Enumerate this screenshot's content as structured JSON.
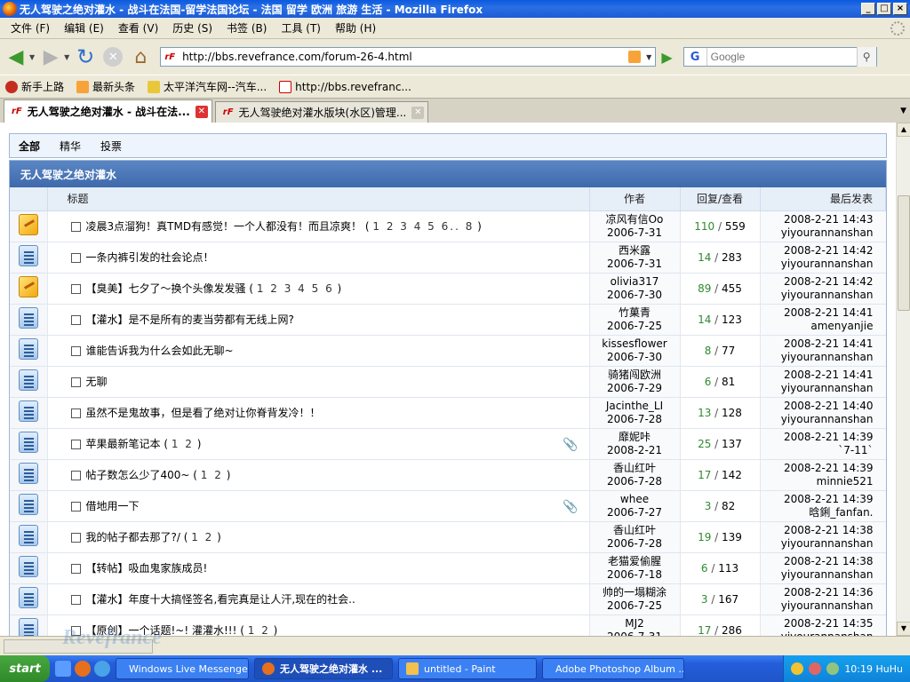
{
  "window": {
    "title": "无人驾驶之绝对灌水 - 战斗在法国-留学法国论坛 - 法国 留学 欧洲 旅游 生活 - Mozilla Firefox",
    "buttons": {
      "minimize": "_",
      "maximize": "□",
      "close": "×"
    }
  },
  "menubar": [
    "文件 (F)",
    "编辑 (E)",
    "查看 (V)",
    "历史 (S)",
    "书签 (B)",
    "工具 (T)",
    "帮助 (H)"
  ],
  "navbar": {
    "url": "http://bbs.revefrance.com/forum-26-4.html",
    "url_favicon": "rF",
    "search_placeholder": "Google",
    "search_engine": "G"
  },
  "bookmarks": [
    "新手上路",
    "最新头条",
    "太平洋汽车网--汽车...",
    "http://bbs.revefranc..."
  ],
  "tabs": [
    {
      "label": "无人驾驶之绝对灌水 - 战斗在法...",
      "active": true
    },
    {
      "label": "无人驾驶绝对灌水版块(水区)管理...",
      "active": false
    }
  ],
  "type_tabs": [
    "全部",
    "精华",
    "投票"
  ],
  "forum": {
    "name": "无人驾驶之绝对灌水",
    "columns": {
      "subject": "标题",
      "author": "作者",
      "stats": "回复/查看",
      "lastpost": "最后发表"
    },
    "threads": [
      {
        "icon": "hot",
        "subject": "凌晨3点溜狗！真TMD有感觉！一个人都没有！而且凉爽！",
        "pages": "1 2 3 4 5 6.. 8",
        "attach": false,
        "author": "凉风有信Oo",
        "date": "2006-7-31",
        "replies": "110",
        "views": "559",
        "last_time": "2008-2-21 14:43",
        "last_user": "yiyourannanshan"
      },
      {
        "icon": "normal",
        "subject": "一条内裤引发的社会论点！",
        "pages": "",
        "attach": false,
        "author": "西米露",
        "date": "2006-7-31",
        "replies": "14",
        "views": "283",
        "last_time": "2008-2-21 14:42",
        "last_user": "yiyourannanshan"
      },
      {
        "icon": "hot",
        "subject": "【臭美】七夕了～换个头像发发骚",
        "pages": "1 2 3 4 5 6",
        "attach": false,
        "author": "olivia317",
        "date": "2006-7-30",
        "replies": "89",
        "views": "455",
        "last_time": "2008-2-21 14:42",
        "last_user": "yiyourannanshan"
      },
      {
        "icon": "normal",
        "subject": "【灌水】是不是所有的麦当劳都有无线上网?",
        "pages": "",
        "attach": false,
        "author": "竹菓青",
        "date": "2006-7-25",
        "replies": "14",
        "views": "123",
        "last_time": "2008-2-21 14:41",
        "last_user": "amenyanjie"
      },
      {
        "icon": "normal",
        "subject": "谁能告诉我为什么会如此无聊~",
        "pages": "",
        "attach": false,
        "author": "kissesflower",
        "date": "2006-7-30",
        "replies": "8",
        "views": "77",
        "last_time": "2008-2-21 14:41",
        "last_user": "yiyourannanshan"
      },
      {
        "icon": "normal",
        "subject": "无聊",
        "pages": "",
        "attach": false,
        "author": "骑猪闯欧洲",
        "date": "2006-7-29",
        "replies": "6",
        "views": "81",
        "last_time": "2008-2-21 14:41",
        "last_user": "yiyourannanshan"
      },
      {
        "icon": "normal",
        "subject": "虽然不是鬼故事，但是看了绝对让你脊背发冷！！",
        "pages": "",
        "attach": false,
        "author": "Jacinthe_LI",
        "date": "2006-7-28",
        "replies": "13",
        "views": "128",
        "last_time": "2008-2-21 14:40",
        "last_user": "yiyourannanshan"
      },
      {
        "icon": "normal",
        "subject": "苹果最新笔记本",
        "pages": "1 2",
        "attach": true,
        "author": "靡妮咔",
        "date": "2008-2-21",
        "replies": "25",
        "views": "137",
        "last_time": "2008-2-21 14:39",
        "last_user": "`7-11`"
      },
      {
        "icon": "normal",
        "subject": "帖子数怎么少了400~",
        "pages": "1 2",
        "attach": false,
        "author": "香山红叶",
        "date": "2006-7-28",
        "replies": "17",
        "views": "142",
        "last_time": "2008-2-21 14:39",
        "last_user": "minnie521"
      },
      {
        "icon": "normal",
        "subject": "借地用一下",
        "pages": "",
        "attach": true,
        "author": "whee",
        "date": "2006-7-27",
        "replies": "3",
        "views": "82",
        "last_time": "2008-2-21 14:39",
        "last_user": "晗鋓_fanfan."
      },
      {
        "icon": "normal",
        "subject": "我的帖子都去那了?/",
        "pages": "1 2",
        "attach": false,
        "author": "香山红叶",
        "date": "2006-7-28",
        "replies": "19",
        "views": "139",
        "last_time": "2008-2-21 14:38",
        "last_user": "yiyourannanshan"
      },
      {
        "icon": "normal",
        "subject": "【转帖】吸血鬼家族成员!",
        "pages": "",
        "attach": false,
        "author": "老猫爱偷腥",
        "date": "2006-7-18",
        "replies": "6",
        "views": "113",
        "last_time": "2008-2-21 14:38",
        "last_user": "yiyourannanshan"
      },
      {
        "icon": "normal",
        "subject": "【灌水】年度十大搞怪签名,看完真是让人汗,现在的社会..",
        "pages": "",
        "attach": false,
        "author": "帅的一塌糊涂",
        "date": "2006-7-25",
        "replies": "3",
        "views": "167",
        "last_time": "2008-2-21 14:36",
        "last_user": "yiyourannanshan"
      },
      {
        "icon": "normal",
        "subject": "【原创】一个话题!~! 灌灌水!!!",
        "pages": "1 2",
        "attach": false,
        "author": "MJ2",
        "date": "2006-7-31",
        "replies": "17",
        "views": "286",
        "last_time": "2008-2-21 14:35",
        "last_user": "yiyourannanshan"
      }
    ]
  },
  "watermark": "Revefrance",
  "taskbar": {
    "start": "start",
    "buttons": [
      {
        "label": "Windows Live Messenger",
        "active": false,
        "color": "#3cb6e8"
      },
      {
        "label": "无人驾驶之绝对灌水 ...",
        "active": true,
        "color": "#e6701e"
      },
      {
        "label": "untitled - Paint",
        "active": false,
        "color": "#f2c14e"
      },
      {
        "label": "Adobe Photoshop Album ...",
        "active": false,
        "color": "#9a1e2e"
      }
    ],
    "clock": "10:19 HuHu"
  }
}
